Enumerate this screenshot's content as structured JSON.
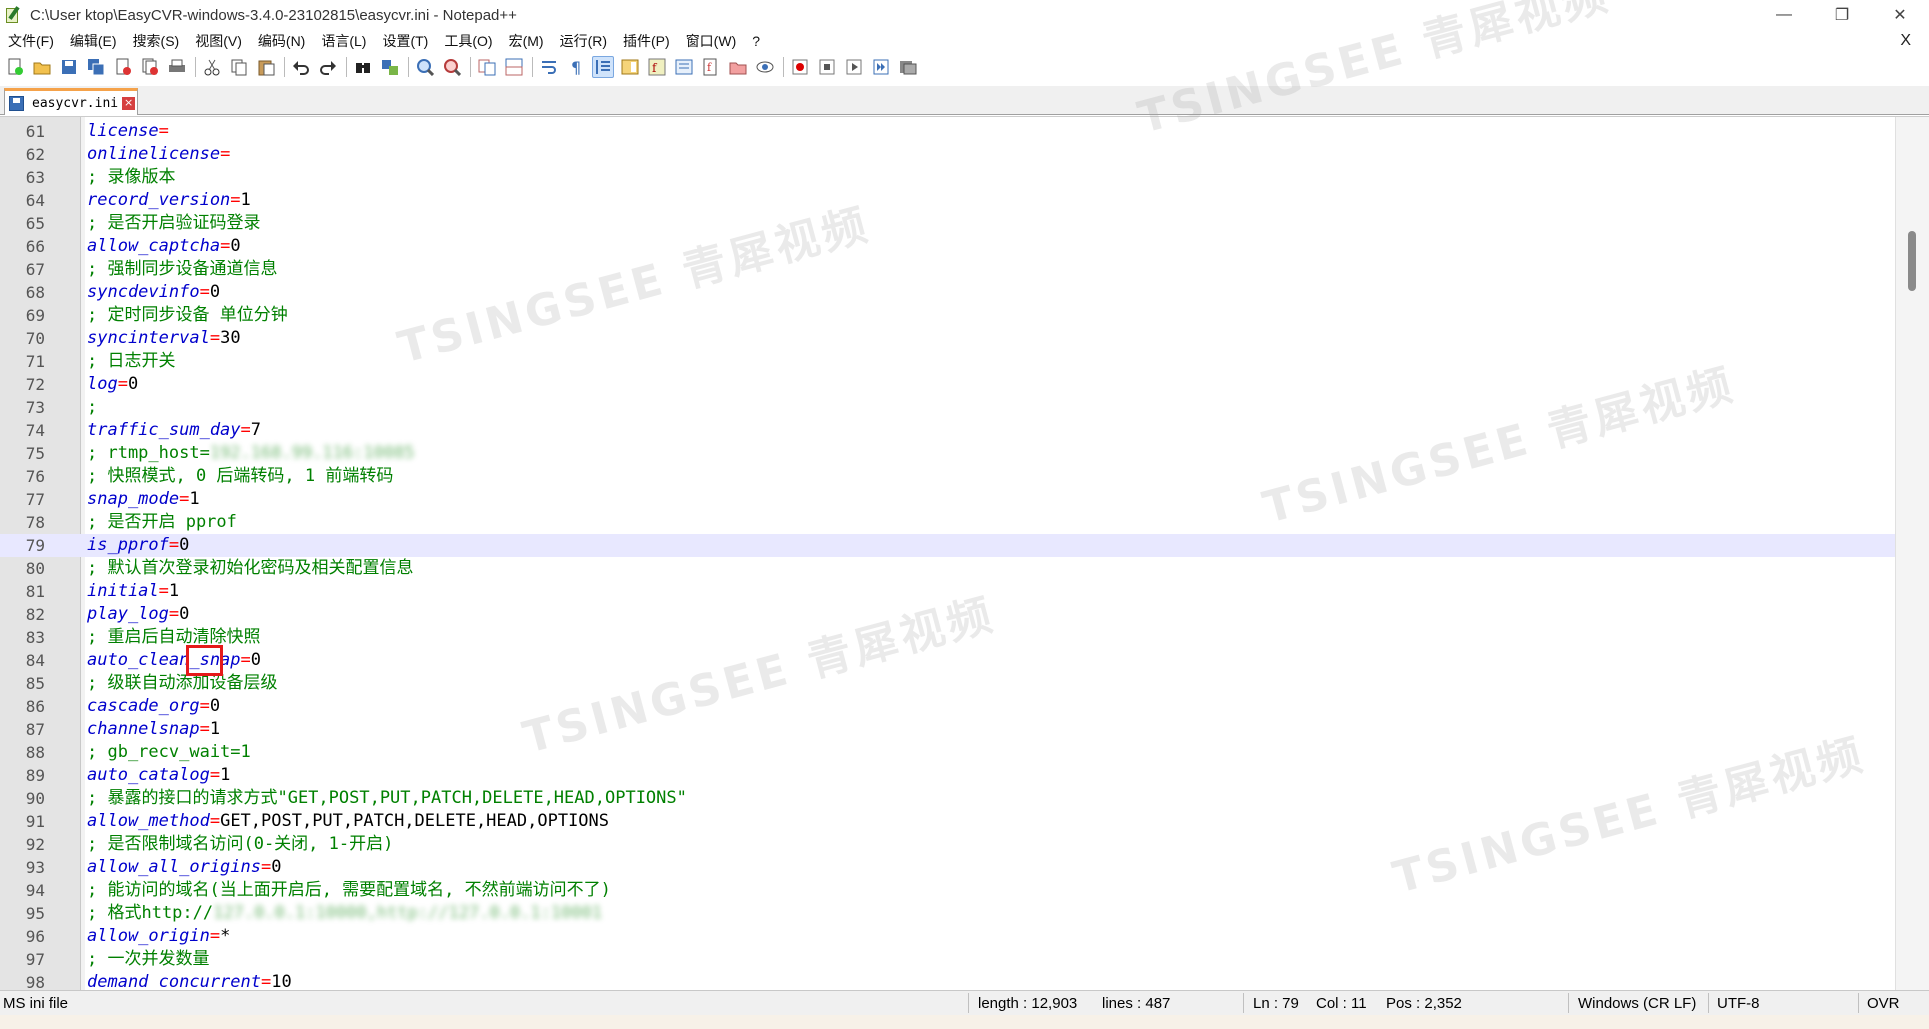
{
  "window": {
    "title": "C:\\User            ktop\\EasyCVR-windows-3.4.0-23102815\\easycvr.ini - Notepad++",
    "minimize": "—",
    "restore": "❐",
    "close": "✕"
  },
  "menu": {
    "items": [
      "文件(F)",
      "编辑(E)",
      "搜索(S)",
      "视图(V)",
      "编码(N)",
      "语言(L)",
      "设置(T)",
      "工具(O)",
      "宏(M)",
      "运行(R)",
      "插件(P)",
      "窗口(W)",
      "?"
    ],
    "close": "X"
  },
  "toolbar": {
    "buttons": [
      "new-file-icon",
      "open-file-icon",
      "save-icon",
      "save-all-icon",
      "close-icon",
      "close-all-icon",
      "print-icon",
      "cut-icon",
      "copy-icon",
      "paste-icon",
      "undo-icon",
      "redo-icon",
      "find-icon",
      "replace-icon",
      "zoom-in-icon",
      "zoom-out-icon",
      "sync-vertical-icon",
      "sync-horizontal-icon",
      "word-wrap-icon",
      "show-all-chars-icon",
      "indent-guide-icon",
      "doc-map-icon",
      "function-list-icon",
      "folder-workspace-icon",
      "doc-switcher-icon",
      "monitoring-icon",
      "record-macro-icon",
      "stop-record-icon",
      "play-macro-icon",
      "run-macro-multiple-icon",
      "save-macro-icon"
    ]
  },
  "tab": {
    "label": "easycvr.ini"
  },
  "editor": {
    "current_line": 79,
    "lines": [
      {
        "n": "61",
        "key": "license",
        "eq": "=",
        "val": ""
      },
      {
        "n": "62",
        "key": "onlinelicense",
        "eq": "=",
        "val": ""
      },
      {
        "n": "63",
        "comment": "; 录像版本"
      },
      {
        "n": "64",
        "key": "record_version",
        "eq": "=",
        "val": "1"
      },
      {
        "n": "65",
        "comment": "; 是否开启验证码登录"
      },
      {
        "n": "66",
        "key": "allow_captcha",
        "eq": "=",
        "val": "0"
      },
      {
        "n": "67",
        "comment": "; 强制同步设备通道信息"
      },
      {
        "n": "68",
        "key": "syncdevinfo",
        "eq": "=",
        "val": "0"
      },
      {
        "n": "69",
        "comment": "; 定时同步设备 单位分钟"
      },
      {
        "n": "70",
        "key": "syncinterval",
        "eq": "=",
        "val": "30"
      },
      {
        "n": "71",
        "comment": "; 日志开关"
      },
      {
        "n": "72",
        "key": "log",
        "eq": "=",
        "val": "0"
      },
      {
        "n": "73",
        "comment": ";"
      },
      {
        "n": "74",
        "key": "traffic_sum_day",
        "eq": "=",
        "val": "7"
      },
      {
        "n": "75",
        "comment": "; rtmp_host=",
        "blurred": "192.168.99.116:10085"
      },
      {
        "n": "76",
        "comment": "; 快照模式, 0 后端转码, 1 前端转码"
      },
      {
        "n": "77",
        "key": "snap_mode",
        "eq": "=",
        "val": "1"
      },
      {
        "n": "78",
        "comment": "; 是否开启 pprof"
      },
      {
        "n": "79",
        "key": "is_pprof",
        "eq": "=",
        "val": "0"
      },
      {
        "n": "80",
        "comment": "; 默认首次登录初始化密码及相关配置信息"
      },
      {
        "n": "81",
        "key": "initial",
        "eq": "=",
        "val": "1"
      },
      {
        "n": "82",
        "key": "play_log",
        "eq": "=",
        "val": "0"
      },
      {
        "n": "83",
        "comment": "; 重启后自动清除快照"
      },
      {
        "n": "84",
        "key": "auto_clean_snap",
        "eq": "=",
        "val": "0"
      },
      {
        "n": "85",
        "comment": "; 级联自动添加设备层级"
      },
      {
        "n": "86",
        "key": "cascade_org",
        "eq": "=",
        "val": "0"
      },
      {
        "n": "87",
        "key": "channelsnap",
        "eq": "=",
        "val": "1"
      },
      {
        "n": "88",
        "comment": "; gb_recv_wait=1"
      },
      {
        "n": "89",
        "key": "auto_catalog",
        "eq": "=",
        "val": "1"
      },
      {
        "n": "90",
        "comment": "; 暴露的接口的请求方式\"GET,POST,PUT,PATCH,DELETE,HEAD,OPTIONS\""
      },
      {
        "n": "91",
        "key": "allow_method",
        "eq": "=",
        "val": "GET,POST,PUT,PATCH,DELETE,HEAD,OPTIONS"
      },
      {
        "n": "92",
        "comment": "; 是否限制域名访问(0-关闭, 1-开启)"
      },
      {
        "n": "93",
        "key": "allow_all_origins",
        "eq": "=",
        "val": "0"
      },
      {
        "n": "94",
        "comment": "; 能访问的域名(当上面开启后, 需要配置域名, 不然前端访问不了)"
      },
      {
        "n": "95",
        "comment": "; 格式http://",
        "blurred": "127.0.0.1:10000,http://127.0.0.1:10001"
      },
      {
        "n": "96",
        "key": "allow_origin",
        "eq": "=",
        "val": "*"
      },
      {
        "n": "97",
        "comment": "; 一次并发数量"
      },
      {
        "n": "98",
        "key": "demand_concurrent",
        "eq": "=",
        "val": "10"
      }
    ]
  },
  "statusbar": {
    "filetype": "MS ini file",
    "length": "length : 12,903",
    "lines": "lines : 487",
    "ln": "Ln : 79",
    "col": "Col : 11",
    "pos": "Pos : 2,352",
    "eol": "Windows (CR LF)",
    "encoding": "UTF-8",
    "mode": "OVR"
  },
  "watermark": {
    "text": "TSINGSEE 青犀视频"
  }
}
